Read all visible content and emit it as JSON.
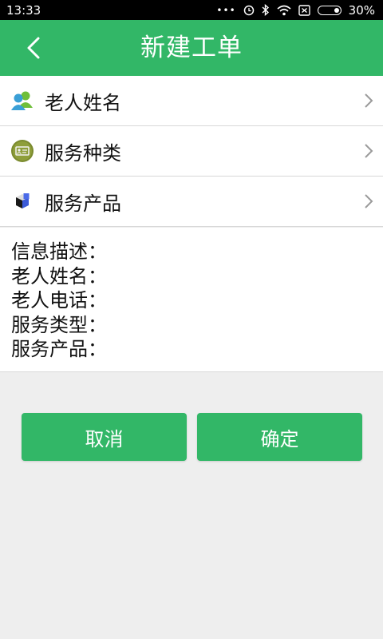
{
  "status_bar": {
    "time": "13:33",
    "dots": "•••",
    "battery_percent": "30%",
    "battery_level": 0.3,
    "icons": [
      "alarm-icon",
      "bluetooth-icon",
      "wifi-icon",
      "sim-icon",
      "battery-icon"
    ]
  },
  "header": {
    "title": "新建工单",
    "back_icon": "chevron-left-icon"
  },
  "menu": {
    "items": [
      {
        "label": "老人姓名",
        "icon": "people-icon"
      },
      {
        "label": "服务种类",
        "icon": "service-card-icon"
      },
      {
        "label": "服务产品",
        "icon": "product-cube-icon"
      }
    ]
  },
  "info": {
    "lines": [
      "信息描述：",
      "老人姓名：",
      "老人电话：",
      "服务类型：",
      "服务产品："
    ]
  },
  "buttons": {
    "cancel": "取消",
    "confirm": "确定"
  },
  "colors": {
    "accent": "#32b767",
    "background": "#eeeeee"
  }
}
